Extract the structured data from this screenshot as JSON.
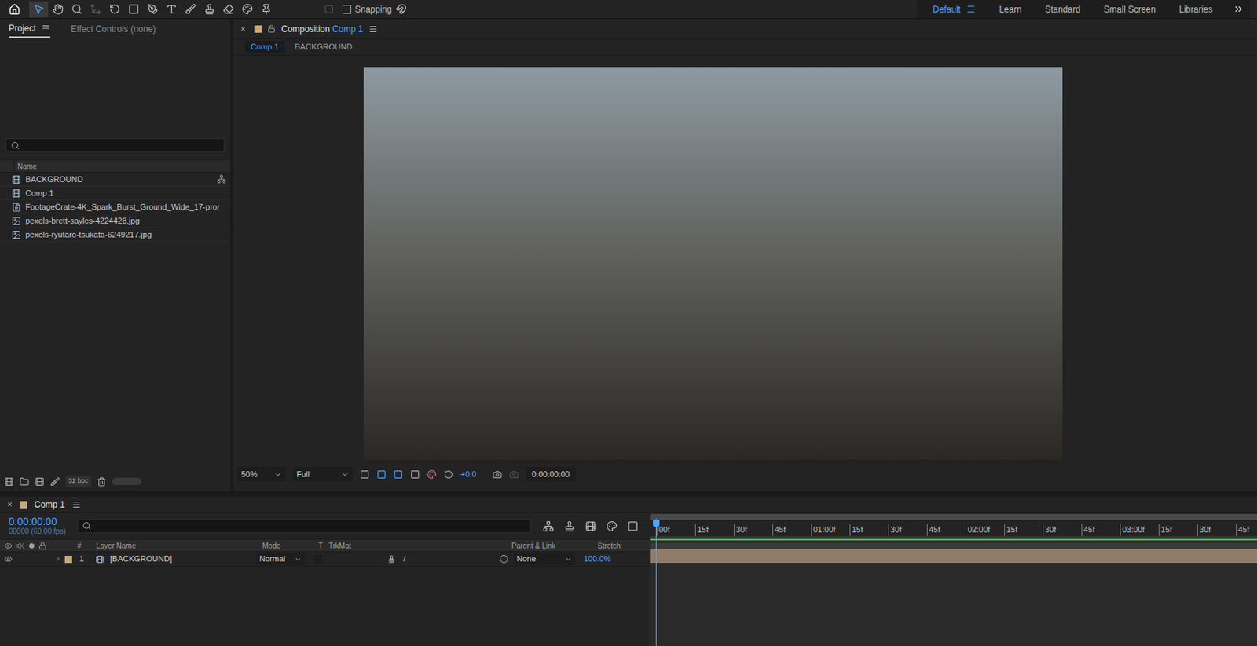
{
  "toolbar": {
    "snapping": {
      "label": "Snapping",
      "checked": false
    },
    "workspaces": [
      {
        "label": "Default",
        "selected": true
      },
      {
        "label": "Learn",
        "selected": false
      },
      {
        "label": "Standard",
        "selected": false
      },
      {
        "label": "Small Screen",
        "selected": false
      },
      {
        "label": "Libraries",
        "selected": false
      }
    ]
  },
  "project_panel": {
    "tabs": [
      {
        "label": "Project",
        "selected": true
      },
      {
        "label": "Effect Controls (none)",
        "selected": false
      }
    ],
    "column": "Name",
    "items": [
      {
        "name": "BACKGROUND",
        "kind": "comp",
        "flow": true
      },
      {
        "name": "Comp 1",
        "kind": "comp",
        "flow": false
      },
      {
        "name": "FootageCrate-4K_Spark_Burst_Ground_Wide_17-pror",
        "kind": "video",
        "flow": false
      },
      {
        "name": "pexels-brett-sayles-4224428.jpg",
        "kind": "image",
        "flow": false
      },
      {
        "name": "pexels-ryutaro-tsukata-6249217.jpg",
        "kind": "image",
        "flow": false
      }
    ],
    "bpc": "32 bpc"
  },
  "composition": {
    "close": "×",
    "prefix": "Composition",
    "name": "Comp 1",
    "breadcrumbs": [
      {
        "label": "Comp 1",
        "selected": true
      },
      {
        "label": "BACKGROUND",
        "selected": false
      }
    ],
    "zoom": "50%",
    "resolution": "Full",
    "exposure": "+0.0",
    "timecode": "0:00:00:00"
  },
  "timeline": {
    "close": "×",
    "tab": "Comp 1",
    "time": "0:00:00:00",
    "frames": "00000 (60.00 fps)",
    "columns": {
      "number": "#",
      "layer_name": "Layer Name",
      "mode": "Mode",
      "t": "T",
      "trkmat": "TrkMat",
      "parent": "Parent & Link",
      "stretch": "Stretch"
    },
    "ruler": [
      "00f",
      "15f",
      "30f",
      "45f",
      "01:00f",
      "15f",
      "30f",
      "45f",
      "02:00f",
      "15f",
      "30f",
      "45f",
      "03:00f",
      "15f",
      "30f",
      "45f"
    ],
    "layers": [
      {
        "number": "1",
        "name": "[BACKGROUND]",
        "mode": "Normal",
        "parent": "None",
        "stretch": "100.0%",
        "visible": true
      }
    ]
  }
}
